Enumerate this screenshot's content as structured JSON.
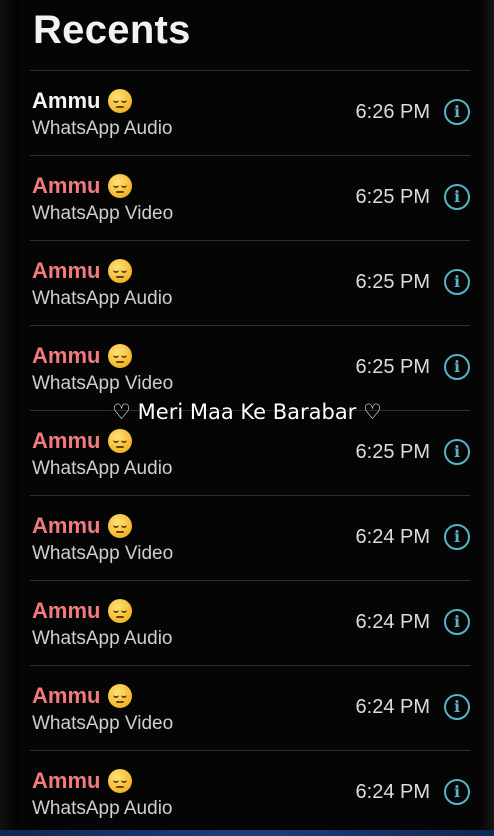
{
  "header": {
    "title": "Recents"
  },
  "overlay_caption": "♡ Meri Maa Ke Barabar ♡",
  "calls": [
    {
      "name": "Ammu",
      "type": "WhatsApp Audio",
      "time": "6:26 PM",
      "missed": false
    },
    {
      "name": "Ammu",
      "type": "WhatsApp Video",
      "time": "6:25 PM",
      "missed": true
    },
    {
      "name": "Ammu",
      "type": "WhatsApp Audio",
      "time": "6:25 PM",
      "missed": true
    },
    {
      "name": "Ammu",
      "type": "WhatsApp Video",
      "time": "6:25 PM",
      "missed": true
    },
    {
      "name": "Ammu",
      "type": "WhatsApp Audio",
      "time": "6:25 PM",
      "missed": true
    },
    {
      "name": "Ammu",
      "type": "WhatsApp Video",
      "time": "6:24 PM",
      "missed": true
    },
    {
      "name": "Ammu",
      "type": "WhatsApp Audio",
      "time": "6:24 PM",
      "missed": true
    },
    {
      "name": "Ammu",
      "type": "WhatsApp Video",
      "time": "6:24 PM",
      "missed": true
    },
    {
      "name": "Ammu",
      "type": "WhatsApp Audio",
      "time": "6:24 PM",
      "missed": true
    }
  ],
  "icons": {
    "contact_emoji": "relieved-face-icon",
    "info_button": "info-circle-icon",
    "info_glyph": "i"
  },
  "colors": {
    "missed_call": "#f07a7c",
    "answered_call": "#f4f4f4",
    "info_accent": "#55b4c7"
  }
}
